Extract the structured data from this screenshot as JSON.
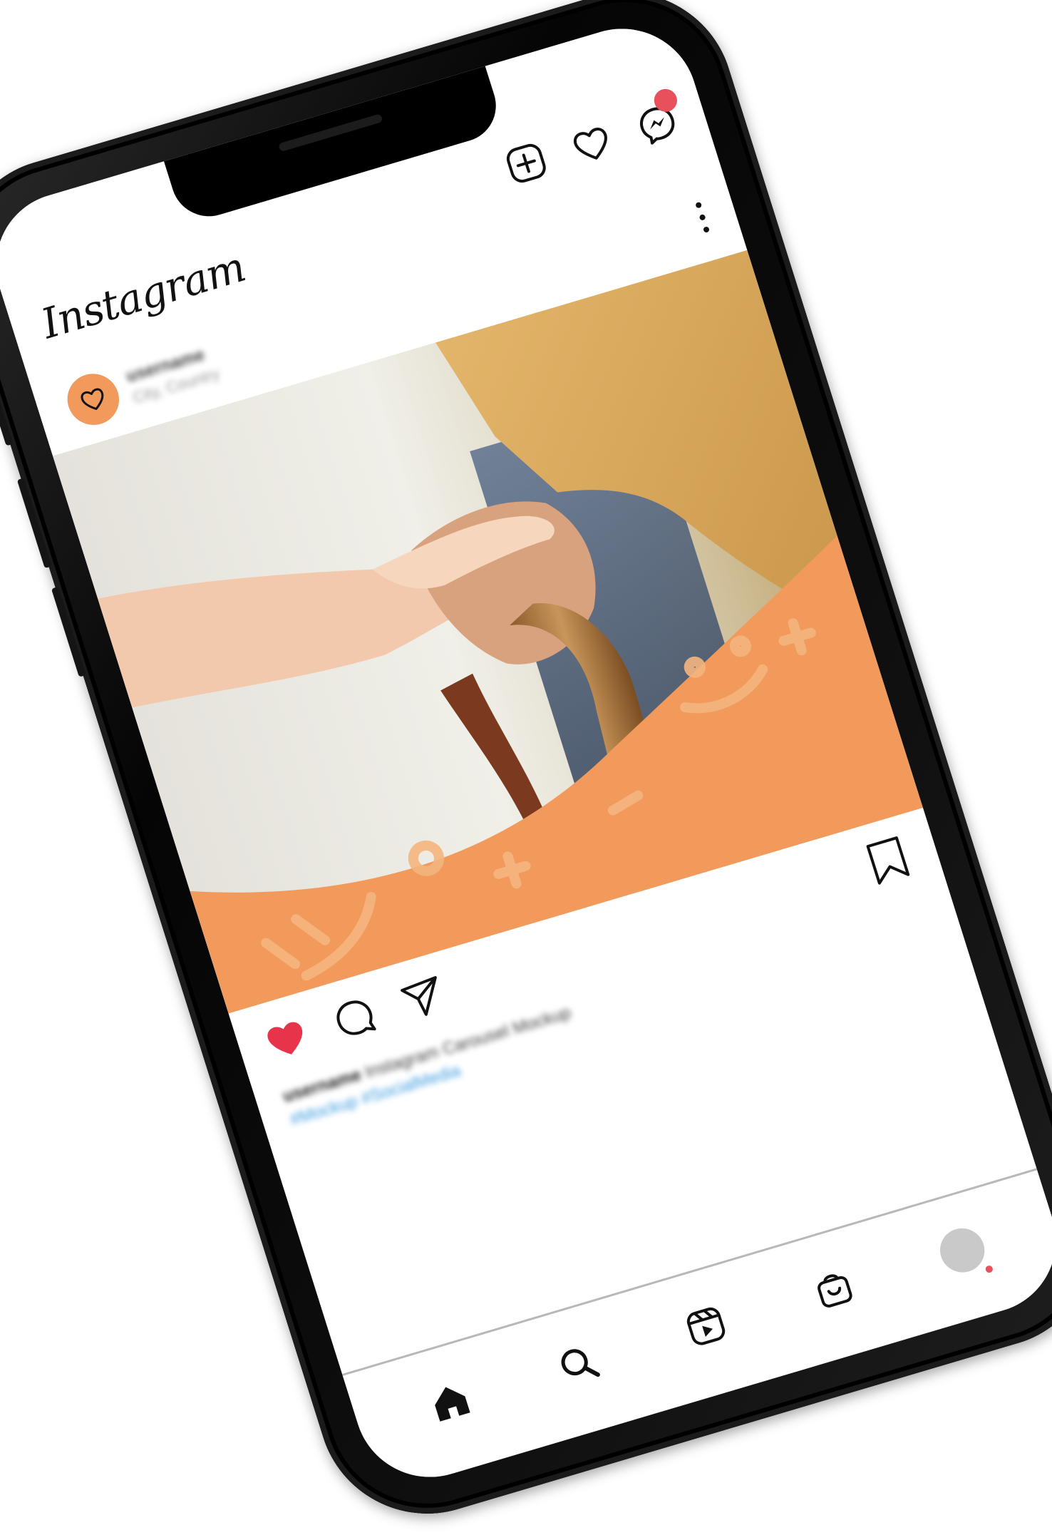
{
  "app": {
    "logo_text": "Instagram"
  },
  "post": {
    "username": "username",
    "location": "City, Country",
    "caption_user": "username",
    "caption_text": "Instagram Carousel Mockup",
    "caption_tags": "#Mockup #SocialMedia",
    "liked": true
  },
  "colors": {
    "accent_orange": "#f19a5b",
    "like_red": "#e8344a",
    "notification_red": "#e8505b",
    "hashtag_blue": "#3b9be0"
  },
  "icons": {
    "top": [
      "plus-square-icon",
      "heart-outline-icon",
      "messenger-icon"
    ],
    "actions": [
      "heart-filled-icon",
      "comment-icon",
      "send-icon",
      "bookmark-icon"
    ],
    "bottom_nav": [
      "home-icon",
      "search-icon",
      "reels-icon",
      "shop-icon",
      "profile-avatar"
    ]
  }
}
